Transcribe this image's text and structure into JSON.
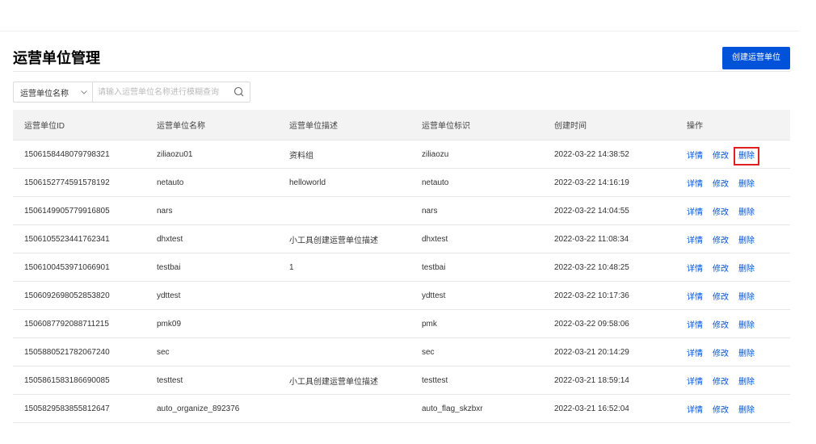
{
  "page": {
    "title": "运营单位管理",
    "create_button": "创建运营单位"
  },
  "search": {
    "field_select": "运营单位名称",
    "placeholder": "请输入运营单位名称进行模糊查询"
  },
  "table": {
    "columns": [
      "运营单位ID",
      "运营单位名称",
      "运营单位描述",
      "运营单位标识",
      "创建时间",
      "操作"
    ],
    "action_labels": {
      "detail": "详情",
      "edit": "修改",
      "delete": "删除"
    },
    "rows": [
      {
        "id": "1506158448079798321",
        "name": "ziliaozu01",
        "desc": "资料组",
        "flag": "ziliaozu",
        "created": "2022-03-22 14:38:52"
      },
      {
        "id": "1506152774591578192",
        "name": "netauto",
        "desc": "helloworld",
        "flag": "netauto",
        "created": "2022-03-22 14:16:19"
      },
      {
        "id": "1506149905779916805",
        "name": "nars",
        "desc": "",
        "flag": "nars",
        "created": "2022-03-22 14:04:55"
      },
      {
        "id": "1506105523441762341",
        "name": "dhxtest",
        "desc": "小工具创建运营单位描述",
        "flag": "dhxtest",
        "created": "2022-03-22 11:08:34"
      },
      {
        "id": "1506100453971066901",
        "name": "testbai",
        "desc": "1",
        "flag": "testbai",
        "created": "2022-03-22 10:48:25"
      },
      {
        "id": "1506092698052853820",
        "name": "ydttest",
        "desc": "",
        "flag": "ydttest",
        "created": "2022-03-22 10:17:36"
      },
      {
        "id": "1506087792088711215",
        "name": "pmk09",
        "desc": "",
        "flag": "pmk",
        "created": "2022-03-22 09:58:06"
      },
      {
        "id": "1505880521782067240",
        "name": "sec",
        "desc": "",
        "flag": "sec",
        "created": "2022-03-21 20:14:29"
      },
      {
        "id": "1505861583186690085",
        "name": "testtest",
        "desc": "小工具创建运营单位描述",
        "flag": "testtest",
        "created": "2022-03-21 18:59:14"
      },
      {
        "id": "1505829583855812647",
        "name": "auto_organize_892376",
        "desc": "",
        "flag": "auto_flag_skzbxr",
        "created": "2022-03-21 16:52:04"
      }
    ]
  },
  "colors": {
    "accent": "#0052d9",
    "highlight_box": "#e02020"
  }
}
